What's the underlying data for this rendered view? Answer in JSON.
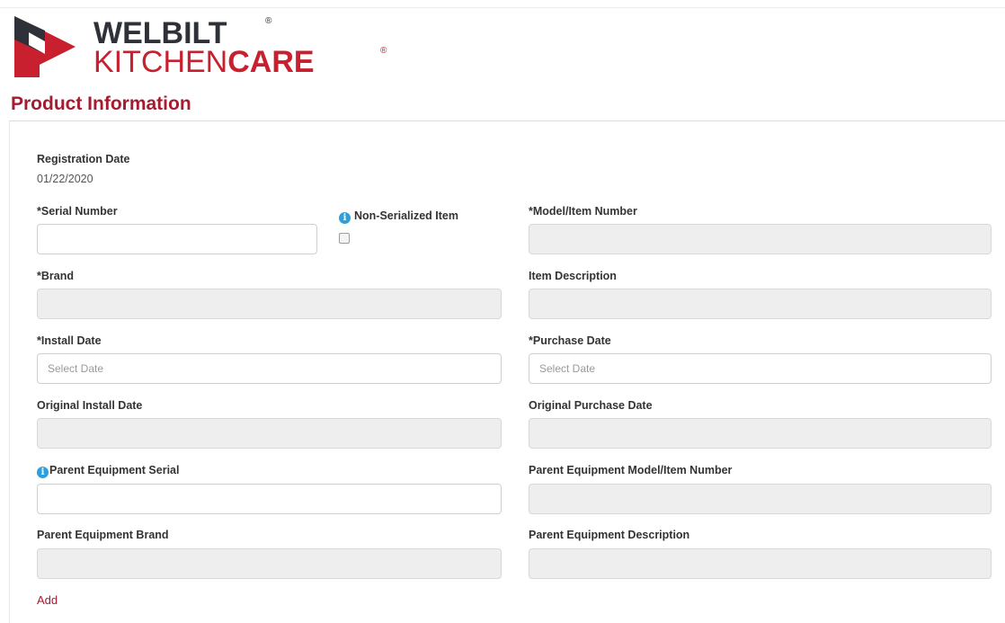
{
  "logo": {
    "line1": "WELBILT",
    "line2_regular": "KITCHEN",
    "line2_bold": "CARE",
    "registered_mark": "®",
    "colors": {
      "dark": "#2e3238",
      "red": "#c8202f"
    }
  },
  "section_title": "Product Information",
  "registration": {
    "label": "Registration Date",
    "value": "01/22/2020"
  },
  "fields": {
    "serial_number": {
      "label": "*Serial Number",
      "value": ""
    },
    "non_serialized": {
      "label": "Non-Serialized Item",
      "checked": false
    },
    "model_number": {
      "label": "*Model/Item Number",
      "value": ""
    },
    "brand": {
      "label": "*Brand",
      "value": ""
    },
    "item_description": {
      "label": "Item Description",
      "value": ""
    },
    "install_date": {
      "label": "*Install Date",
      "placeholder": "Select Date"
    },
    "purchase_date": {
      "label": "*Purchase Date",
      "placeholder": "Select Date"
    },
    "original_install_date": {
      "label": "Original Install Date",
      "value": ""
    },
    "original_purchase_date": {
      "label": "Original Purchase Date",
      "value": ""
    },
    "parent_serial": {
      "label": "Parent Equipment Serial",
      "value": ""
    },
    "parent_model": {
      "label": "Parent Equipment Model/Item Number",
      "value": ""
    },
    "parent_brand": {
      "label": "Parent Equipment Brand",
      "value": ""
    },
    "parent_description": {
      "label": "Parent Equipment Description",
      "value": ""
    }
  },
  "info_icon_glyph": "i",
  "add_link": "Add",
  "colors": {
    "accent": "#a51c30",
    "info": "#2f9fd8",
    "readonly_bg": "#eeeeee"
  }
}
